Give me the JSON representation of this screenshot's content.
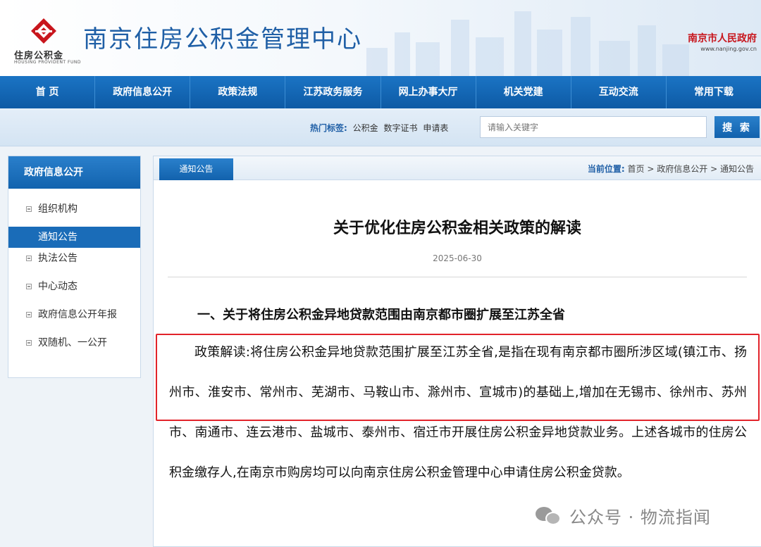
{
  "header": {
    "logo_cn": "住房公积金",
    "logo_en": "HOUSING PROVIDENT FUND",
    "site_title": "南京住房公积金管理中心",
    "gov_name": "南京市人民政府",
    "gov_url": "www.nanjing.gov.cn"
  },
  "nav": {
    "items": [
      "首 页",
      "政府信息公开",
      "政策法规",
      "江苏政务服务",
      "网上办事大厅",
      "机关党建",
      "互动交流",
      "常用下载"
    ]
  },
  "search": {
    "hot_label": "热门标签:",
    "hot_tags": [
      "公积金",
      "数字证书",
      "申请表"
    ],
    "placeholder": "请输入关键字",
    "button_label": "搜 索"
  },
  "sidebar": {
    "title": "政府信息公开",
    "items": [
      {
        "label": "组织机构",
        "active": false
      },
      {
        "label": "通知公告",
        "active": true
      },
      {
        "label": "执法公告",
        "active": false
      },
      {
        "label": "中心动态",
        "active": false
      },
      {
        "label": "政府信息公开年报",
        "active": false
      },
      {
        "label": "双随机、一公开",
        "active": false
      }
    ]
  },
  "main": {
    "tab_label": "通知公告",
    "breadcrumb": {
      "label": "当前位置:",
      "items": [
        "首页",
        "政府信息公开",
        "通知公告"
      ],
      "separator": ">"
    },
    "article": {
      "title": "关于优化住房公积金相关政策的解读",
      "date": "2025-06-30",
      "section_heading": "一、关于将住房公积金异地贷款范围由南京都市圈扩展至江苏全省",
      "paragraph": "政策解读:将住房公积金异地贷款范围扩展至江苏全省,是指在现有南京都市圈所涉区域(镇江市、扬州市、淮安市、常州市、芜湖市、马鞍山市、滁州市、宣城市)的基础上,增加在无锡市、徐州市、苏州市、南通市、连云港市、盐城市、泰州市、宿迁市开展住房公积金异地贷款业务。上述各城市的住房公积金缴存人,在南京市购房均可以向南京住房公积金管理中心申请住房公积金贷款。"
    }
  },
  "watermark": {
    "text": "公众号 · 物流指闻"
  },
  "colors": {
    "brand_blue": "#1f5fa6",
    "nav_blue": "#1262ad",
    "highlight_red": "#e2232a",
    "gov_red": "#c8161d"
  }
}
